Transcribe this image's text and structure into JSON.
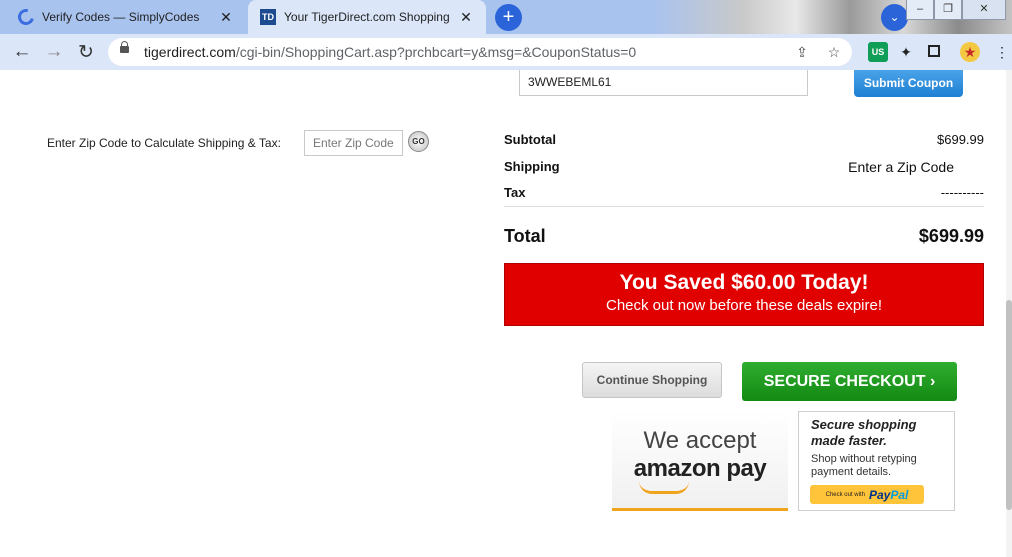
{
  "browser": {
    "tabs": [
      {
        "title": "Verify Codes — SimplyCodes",
        "active": false
      },
      {
        "title": "Your TigerDirect.com Shopping C",
        "active": true
      }
    ],
    "new_tab_symbol": "+",
    "close_symbol": "✕",
    "url_host": "tigerdirect.com",
    "url_path": "/cgi-bin/ShoppingCart.asp?prchbcart=y&msg=&CouponStatus=0",
    "extension_badge": "US"
  },
  "coupon": {
    "code": "3WWEBEML61",
    "submit_label": "Submit Coupon"
  },
  "shipping": {
    "label": "Enter Zip Code to Calculate Shipping & Tax:",
    "placeholder": "Enter Zip Code",
    "go_label": "GO"
  },
  "summary": {
    "subtotal_label": "Subtotal",
    "subtotal_value": "$699.99",
    "shipping_label": "Shipping",
    "shipping_value": "Enter a Zip Code",
    "tax_label": "Tax",
    "tax_value": "----------",
    "total_label": "Total",
    "total_value": "$699.99"
  },
  "savings": {
    "title": "You Saved $60.00 Today!",
    "subtitle": "Check out now before these deals expire!",
    "color": "#e00000"
  },
  "actions": {
    "continue_label": "Continue Shopping",
    "checkout_label": "SECURE CHECKOUT ›",
    "checkout_color": "#1a961a"
  },
  "payments": {
    "amazon_line1": "We accept",
    "amazon_line2": "amazon pay",
    "paypal_title": "Secure shopping made faster.",
    "paypal_sub": "Shop without retyping payment details.",
    "paypal_btn_prefix": "Check out with",
    "paypal_logo_pay": "Pay",
    "paypal_logo_pal": "Pal"
  }
}
